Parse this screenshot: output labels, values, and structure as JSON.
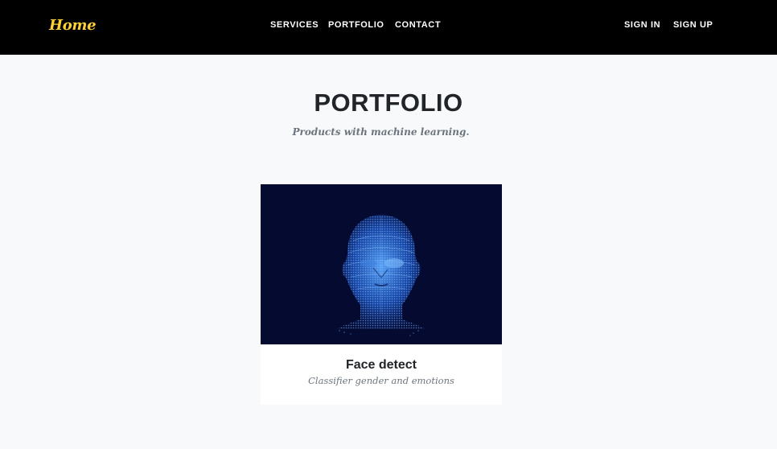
{
  "navbar": {
    "brand": "Home",
    "links": [
      "SERVICES",
      "PORTFOLIO",
      "CONTACT"
    ],
    "auth": [
      "SIGN IN",
      "SIGN UP"
    ]
  },
  "portfolio": {
    "heading": "PORTFOLIO",
    "subheading": "Products with machine learning.",
    "items": [
      {
        "title": "Face detect",
        "subtitle": "Classifier gender and emotions",
        "image": "wireframe-face-icon"
      }
    ]
  },
  "colors": {
    "navbar_bg": "#000000",
    "brand": "#fed136",
    "page_bg": "#f8f9fa",
    "card_image_bg": "#040a30",
    "face_glow": "#3a8bff"
  }
}
